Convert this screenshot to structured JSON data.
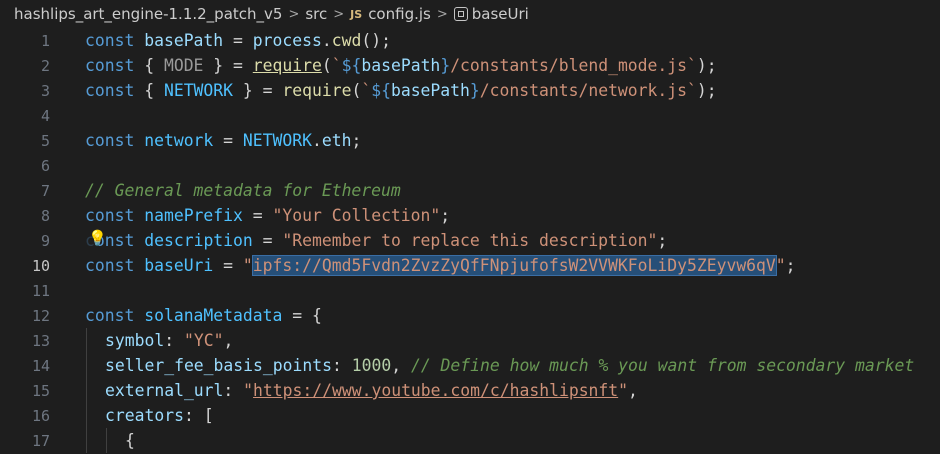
{
  "breadcrumb": {
    "project": "hashlips_art_engine-1.1.2_patch_v5",
    "sep": ">",
    "folder": "src",
    "js_badge": "JS",
    "file": "config.js",
    "symbol": "baseUri"
  },
  "editor": {
    "active_line": 10,
    "lines": [
      {
        "n": "1"
      },
      {
        "n": "2"
      },
      {
        "n": "3"
      },
      {
        "n": "4"
      },
      {
        "n": "5"
      },
      {
        "n": "6"
      },
      {
        "n": "7"
      },
      {
        "n": "8"
      },
      {
        "n": "9"
      },
      {
        "n": "10"
      },
      {
        "n": "11"
      },
      {
        "n": "12"
      },
      {
        "n": "13"
      },
      {
        "n": "14"
      },
      {
        "n": "15"
      },
      {
        "n": "16"
      },
      {
        "n": "17"
      }
    ],
    "code": {
      "l1": {
        "kw": "const",
        "name": "basePath",
        "eq": " = ",
        "obj": "process",
        "dot": ".",
        "fn": "cwd",
        "end": "();"
      },
      "l2": {
        "kw": "const",
        "open": " { ",
        "name": "MODE",
        "close": " } = ",
        "fn": "require",
        "p1": "(",
        "tick1": "`",
        "interp_open": "${",
        "var": "basePath",
        "interp_close": "}",
        "path": "/constants/blend_mode.js",
        "tick2": "`",
        "end": ");"
      },
      "l3": {
        "kw": "const",
        "open": " { ",
        "name": "NETWORK",
        "close": " } = ",
        "fn": "require",
        "p1": "(",
        "tick1": "`",
        "interp_open": "${",
        "var": "basePath",
        "interp_close": "}",
        "path": "/constants/network.js",
        "tick2": "`",
        "end": ");"
      },
      "l5": {
        "kw": "const",
        "name": "network",
        "eq": " = ",
        "obj": "NETWORK",
        "dot": ".",
        "prop": "eth",
        "end": ";"
      },
      "l7": {
        "comment": "// General metadata for Ethereum"
      },
      "l8": {
        "kw": "const",
        "name": "namePrefix",
        "eq": " = ",
        "str": "\"Your Collection\"",
        "end": ";"
      },
      "l9": {
        "kw_hidden": "c",
        "kw": "onst",
        "name": "description",
        "eq": " = ",
        "str": "\"Remember to replace this description\"",
        "end": ";"
      },
      "l10": {
        "kw": "const",
        "name": "baseUri",
        "eq": " = ",
        "q1": "\"",
        "selected": "ipfs://Qmd5Fvdn2ZvzZyQfFNpjufofsW2VVWKFoLiDy5ZEyvw6qV",
        "q2": "\"",
        "end": ";"
      },
      "l12": {
        "kw": "const",
        "name": "solanaMetadata",
        "eq": " = ",
        "end": "{"
      },
      "l13": {
        "prop": "symbol",
        "colon": ": ",
        "str": "\"YC\"",
        "end": ","
      },
      "l14": {
        "prop": "seller_fee_basis_points",
        "colon": ": ",
        "num": "1000",
        "comma": ", ",
        "comment": "// Define how much % you want from secondary market"
      },
      "l15": {
        "prop": "external_url",
        "colon": ": ",
        "str_q1": "\"",
        "url": "https://www.youtube.com/c/hashlipsnft",
        "str_q2": "\"",
        "end": ","
      },
      "l16": {
        "prop": "creators",
        "colon": ": ",
        "end": "["
      },
      "l17": {
        "brace": "{"
      }
    }
  }
}
